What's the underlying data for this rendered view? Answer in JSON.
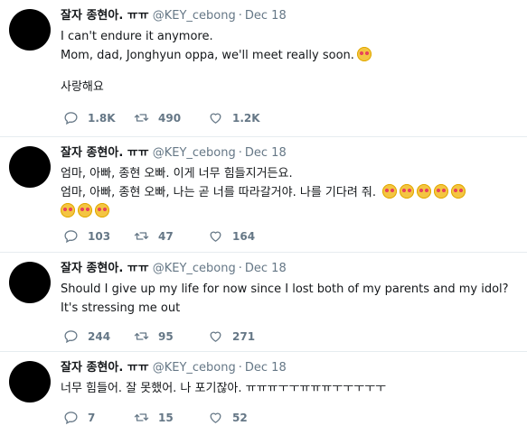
{
  "tweets": [
    {
      "name": "잘자 종현아. ㅠㅠ",
      "handle": "@KEY_cebong",
      "separator": "·",
      "date": "Dec 18",
      "lines": [
        "I can't endure it anymore.",
        "Mom, dad, Jonghyun oppa, we'll meet really soon."
      ],
      "extra": "사랑해요",
      "replies": "1.8K",
      "retweets": "490",
      "likes": "1.2K"
    },
    {
      "name": "잘자 종현아. ㅠㅠ",
      "handle": "@KEY_cebong",
      "separator": "·",
      "date": "Dec 18",
      "lines": [
        "엄마, 아빠, 종현 오빠. 이게 너무 힘들지거든요.",
        "엄마, 아빠, 종현 오빠, 나는 곧 너를 따라갈거야. 나를 기다려 줘."
      ],
      "replies": "103",
      "retweets": "47",
      "likes": "164"
    },
    {
      "name": "잘자 종현아. ㅠㅠ",
      "handle": "@KEY_cebong",
      "separator": "·",
      "date": "Dec 18",
      "lines": [
        "Should I give up my life for now since I lost both of my parents and my idol?",
        "It's stressing me out"
      ],
      "replies": "244",
      "retweets": "95",
      "likes": "271"
    },
    {
      "name": "잘자 종현아. ㅠㅠ",
      "handle": "@KEY_cebong",
      "separator": "·",
      "date": "Dec 18",
      "lines": [
        "너무 힘들어. 잘 못했어. 나 포기잖아. ㅠㅠㅠㅜㅜㅠㅠㅠㅜㅜㅜㅜㅜ"
      ],
      "replies": "7",
      "retweets": "15",
      "likes": "52"
    }
  ],
  "icons": {
    "reply": "reply-icon",
    "retweet": "retweet-icon",
    "like": "heart-icon",
    "emoji": "smiling-face-with-heart-eyes-emoji"
  }
}
